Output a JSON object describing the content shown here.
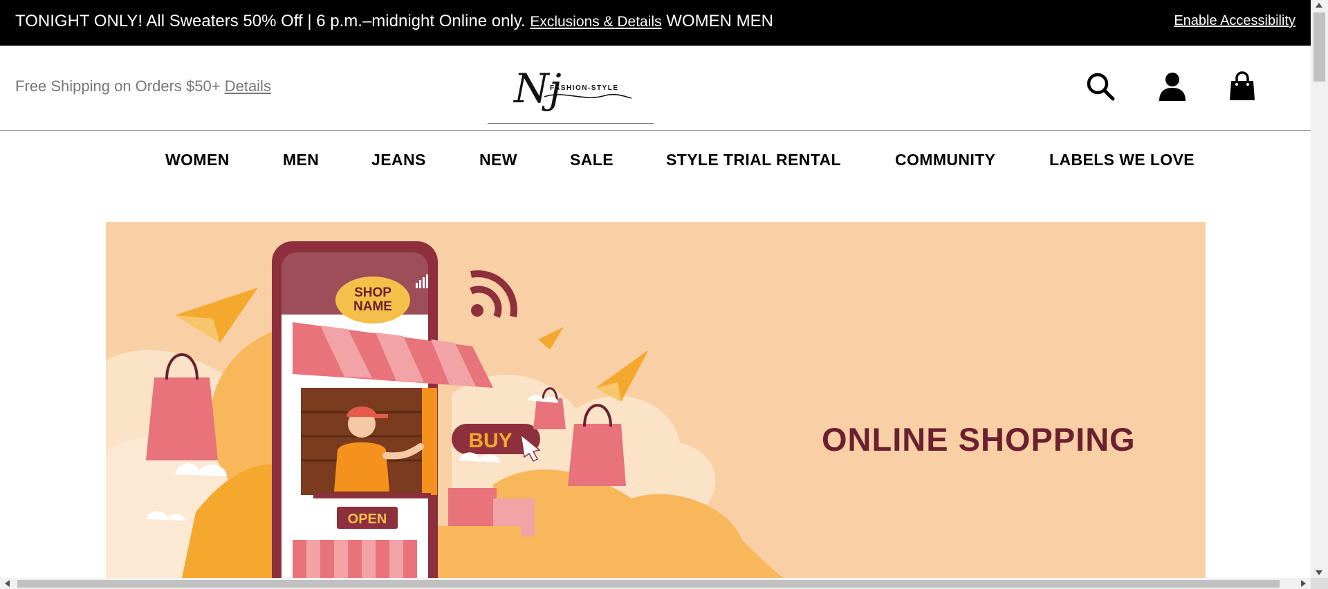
{
  "promo": {
    "text": "TONIGHT ONLY! All Sweaters 50% Off | 6 p.m.–midnight Online only.",
    "link": "Exclusions & Details",
    "women": "WOMEN",
    "men": "MEN",
    "accessibility": "Enable Accessibility"
  },
  "header": {
    "shipping_text": "Free Shipping on Orders $50+",
    "shipping_link": "Details",
    "logo_monogram": "Nj",
    "logo_wordmark": "FASHION-STYLE",
    "icons": [
      "search-icon",
      "account-icon",
      "shopping-bag-icon"
    ]
  },
  "nav": {
    "items": [
      "WOMEN",
      "MEN",
      "JEANS",
      "NEW",
      "SALE",
      "STYLE TRIAL RENTAL",
      "COMMUNITY",
      "LABELS WE LOVE"
    ]
  },
  "hero": {
    "title": "ONLINE SHOPPING",
    "shop_sign_line1": "SHOP",
    "shop_sign_line2": "NAME",
    "buy_label": "BUY",
    "open_label": "OPEN"
  },
  "colors": {
    "promo_bg": "#000000",
    "hero_bg": "#f9d0a6",
    "hero_title": "#6b2030",
    "accent_pink": "#e8737a",
    "accent_orange": "#f4a92e"
  }
}
